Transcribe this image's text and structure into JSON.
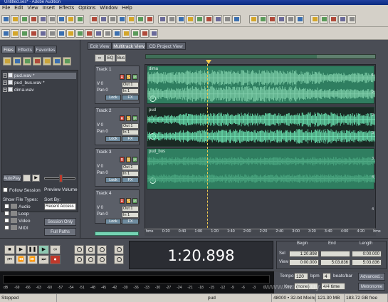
{
  "titlebar": {
    "title": "Untitled.ses* - Adobe Audition"
  },
  "menu": [
    "File",
    "Edit",
    "View",
    "Insert",
    "Effects",
    "Options",
    "Window",
    "Help"
  ],
  "file_panel": {
    "tabs": [
      "Files",
      "Effects",
      "Favorites"
    ],
    "files": [
      "pud.wav *",
      "pud_bus.wav *",
      "dima.wav"
    ],
    "autoplay_label": "AutoPlay",
    "follow_label": "Follow Session",
    "preview_label": "Preview Volume",
    "show_types_label": "Show File Types:",
    "sort_by_label": "Sort By:",
    "types": [
      "Audio",
      "Loop",
      "Video",
      "MIDI"
    ],
    "sort_value": "Recent Access",
    "session_btn": "Session Only",
    "fullpaths_btn": "Full Paths"
  },
  "views": {
    "tabs": [
      "Edit View",
      "Multitrack View",
      "CD Project View"
    ],
    "mini_buttons": [
      "∞",
      "EQ",
      "Bus"
    ]
  },
  "tracks": [
    {
      "name": "Track 1",
      "v": "V 0",
      "pan": "Pan 0",
      "out": "Out 1",
      "in": "In 1",
      "read": "Read",
      "fx": "FX",
      "lock": "Lock",
      "clip": "dima",
      "db": [
        "1",
        "2"
      ]
    },
    {
      "name": "Track 2",
      "v": "V 0",
      "pan": "Pan 0",
      "out": "Out 1",
      "in": "In 1",
      "read": "Read",
      "fx": "FX",
      "lock": "Lock",
      "clip": "pud",
      "db": [
        "2",
        "3"
      ]
    },
    {
      "name": "Track 3",
      "v": "V 0",
      "pan": "Pan 0",
      "out": "Out 1",
      "in": "In 1",
      "read": "Read",
      "fx": "FX",
      "lock": "Lock",
      "clip": "pud_bus",
      "db": [
        "3",
        "4"
      ]
    },
    {
      "name": "Track 4",
      "v": "V 0",
      "pan": "Pan 0",
      "out": "Out 1",
      "in": "In 1",
      "read": "Read",
      "fx": "FX",
      "lock": "Lock",
      "clip": "",
      "db": [
        "4"
      ]
    }
  ],
  "ruler": [
    "hms",
    "0:20",
    "0:40",
    "1:00",
    "1:20",
    "1:40",
    "2:00",
    "2:20",
    "2:40",
    "3:00",
    "3:20",
    "3:40",
    "4:00",
    "4:20",
    "hms"
  ],
  "time_display": "1:20.898",
  "selview": {
    "headers": [
      "Begin",
      "End",
      "Length"
    ],
    "sel_label": "Sel",
    "view_label": "View",
    "sel": [
      "1:20.898",
      "",
      "0:00.000"
    ],
    "view": [
      "0:00.000",
      "5:03.836",
      "5:03.836"
    ]
  },
  "meter_scale": [
    "dB",
    "-69",
    "-66",
    "-63",
    "-60",
    "-57",
    "-54",
    "-51",
    "-48",
    "-45",
    "-42",
    "-39",
    "-36",
    "-33",
    "-30",
    "-27",
    "-24",
    "-21",
    "-18",
    "-15",
    "-12",
    "-9",
    "-6",
    "-3",
    "0"
  ],
  "tempo": {
    "tempo_label": "Tempo",
    "tempo_value": "120",
    "bpm_label": "bpm",
    "beats_value": "4",
    "beats_label": "beats/bar",
    "advanced_btn": "Advanced...",
    "key_label": "Key",
    "key_value": "(none)",
    "time_sig": "4/4 time",
    "metronome_btn": "Metronome"
  },
  "status": {
    "left": "Stopped",
    "file": "pud",
    "format": "48000 • 32-bit Mixing",
    "mem": "121.30 MB",
    "free": "183.72 GB free"
  },
  "watermark": "www.audiobuy.cn",
  "colors": {
    "waveform": "#2f7e60",
    "waveform_bright": "#8ad8b6",
    "selected_clip_bg": "#1a2a24",
    "panel": "#4a4d55",
    "cursor": "#f0c950"
  }
}
